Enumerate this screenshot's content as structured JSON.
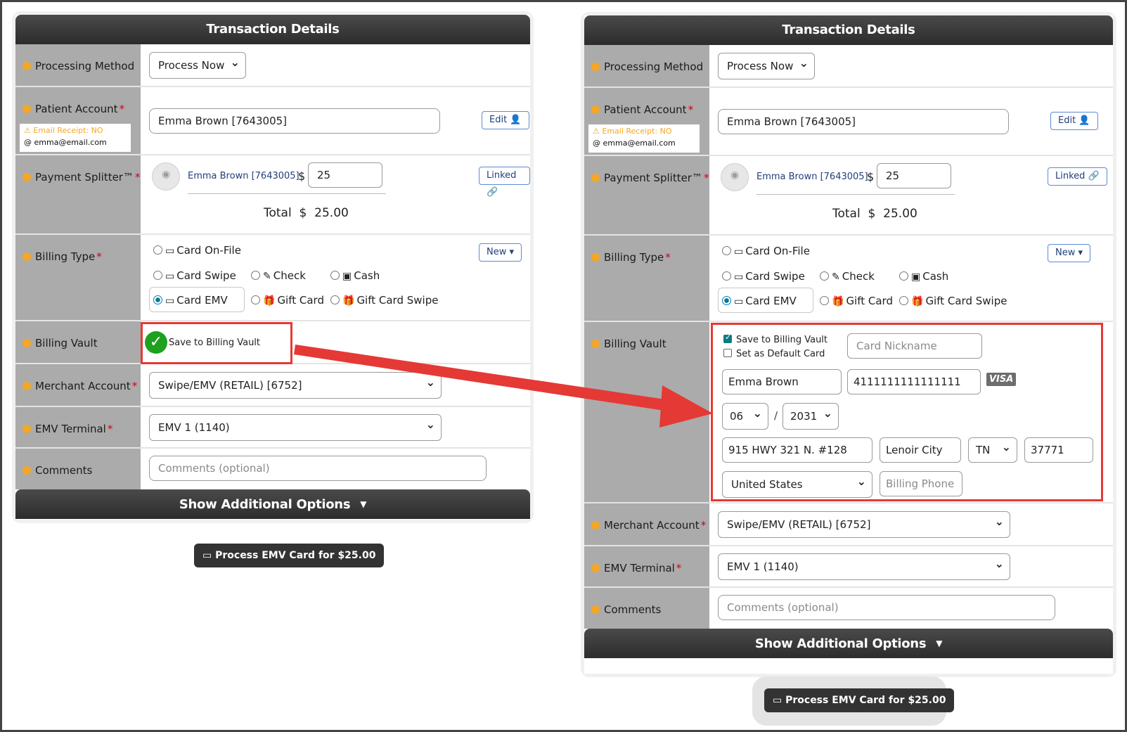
{
  "header_title": "Transaction Details",
  "labels": {
    "processing_method": "Processing Method",
    "patient_account": "Patient Account",
    "payment_splitter": "Payment Splitter™",
    "billing_type": "Billing Type",
    "billing_vault": "Billing Vault",
    "merchant_account": "Merchant Account",
    "emv_terminal": "EMV Terminal",
    "comments": "Comments",
    "required_mark": "*"
  },
  "processing_method": "Process Now",
  "patient": {
    "account": "Emma Brown [7643005]",
    "email_receipt": "Email Receipt: NO",
    "email": "emma@email.com",
    "edit_label": "Edit"
  },
  "splitter": {
    "name": "Emma Brown [7643005]",
    "currency": "$",
    "amount": "25",
    "total_label": "Total",
    "total_value": "25.00",
    "linked_label": "Linked"
  },
  "billing_type": {
    "new_label": "New",
    "options": [
      "Card On-File",
      "Card Swipe",
      "Check",
      "Cash",
      "Card EMV",
      "Gift Card",
      "Gift Card Swipe"
    ],
    "selected": "Card EMV"
  },
  "billing_vault": {
    "save_label": "Save to Billing Vault",
    "default_label": "Set as Default Card",
    "card_nickname_placeholder": "Card Nickname",
    "cardholder": "Emma Brown",
    "card_number": "4111111111111111",
    "card_brand": "VISA",
    "exp_month": "06",
    "exp_sep": "/",
    "exp_year": "2031",
    "address": "915 HWY 321 N. #128",
    "city": "Lenoir City",
    "state": "TN",
    "zip": "37771",
    "country": "United States",
    "phone_placeholder": "Billing Phone"
  },
  "merchant_account": "Swipe/EMV (RETAIL) [6752]",
  "emv_terminal": "EMV 1 (1140)",
  "comments_placeholder": "Comments (optional)",
  "show_options": "Show Additional Options",
  "process_button": "Process EMV Card for $25.00",
  "colors": {
    "highlight": "#e53935",
    "header": "#333333",
    "label_bg": "#ababab"
  }
}
